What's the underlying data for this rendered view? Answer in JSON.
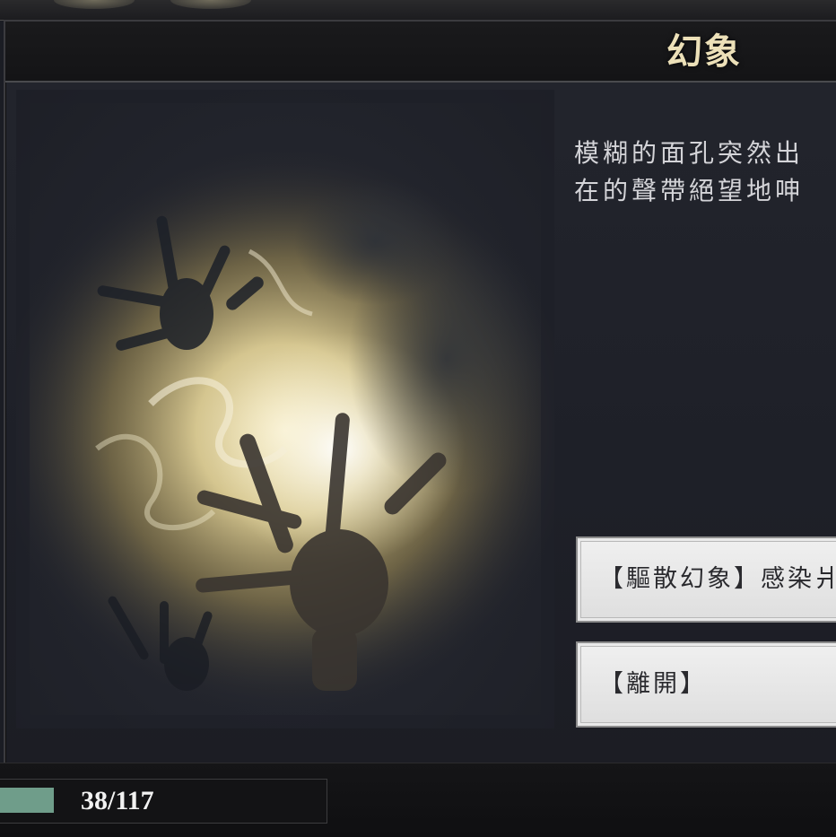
{
  "event": {
    "title": "幻象",
    "description_lines": [
      "模糊的面孔突然出",
      "在的聲帶絕望地呻"
    ],
    "choices": [
      {
        "label": "【驅散幻象】感染爿"
      },
      {
        "label": "【離開】"
      }
    ]
  },
  "status": {
    "hp_text": "38/117",
    "hp_current": 38,
    "hp_max": 117,
    "hp_color": "#6f9d8a"
  }
}
